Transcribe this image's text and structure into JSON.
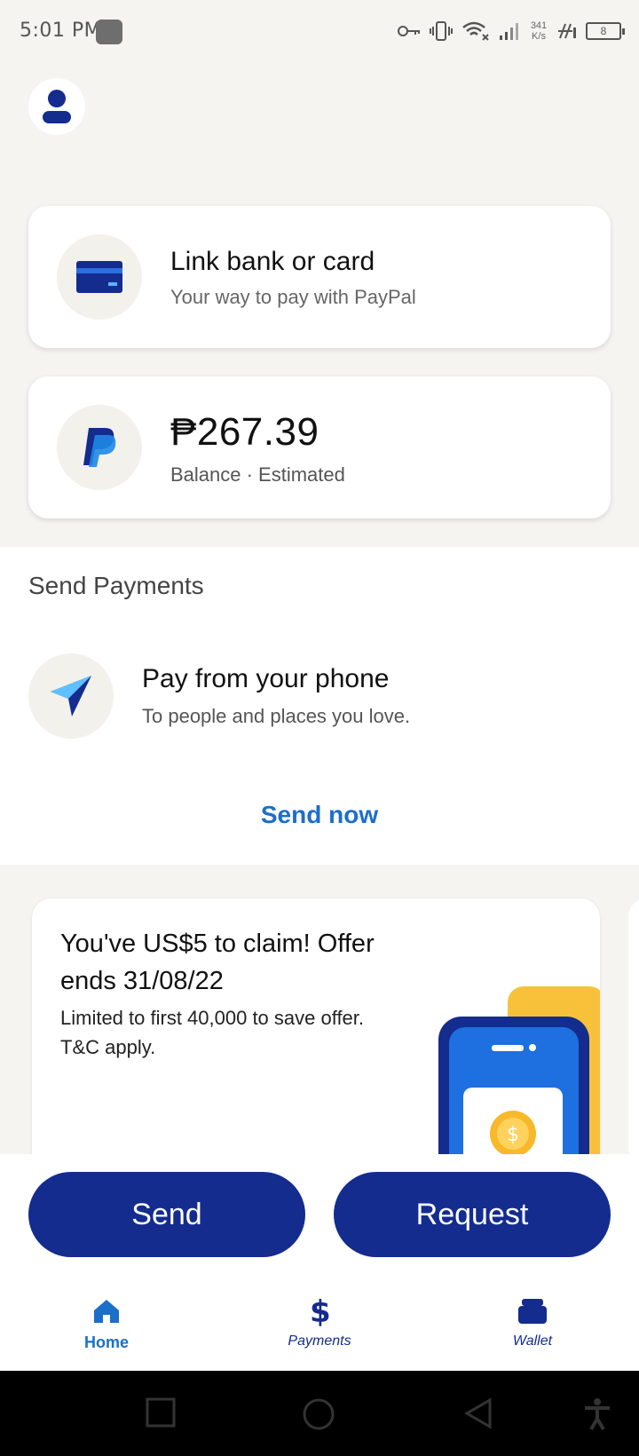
{
  "status_bar": {
    "time": "5:01 PM",
    "net_speed_value": "341",
    "net_speed_unit": "K/s",
    "battery": "8"
  },
  "profile": {
    "icon": "person-icon"
  },
  "link_card": {
    "title": "Link bank or card",
    "subtitle": "Your way to pay with PayPal",
    "icon": "credit-card-icon"
  },
  "balance_card": {
    "amount": "₱267.39",
    "subtitle": "Balance · Estimated",
    "icon": "paypal-logo"
  },
  "send_payments": {
    "section_title": "Send Payments",
    "title": "Pay from your phone",
    "subtitle": "To people and places you love.",
    "cta": "Send now",
    "icon": "send-paper-plane-icon"
  },
  "promo": {
    "title": "You've US$5 to claim! Offer ends 31/08/22",
    "subtitle": "Limited to first 40,000 to save offer. T&C apply."
  },
  "actions": {
    "send_label": "Send",
    "request_label": "Request"
  },
  "tabs": [
    {
      "label": "Home",
      "icon": "home-icon",
      "active": true
    },
    {
      "label": "Payments",
      "icon": "dollar-icon",
      "active": false
    },
    {
      "label": "Wallet",
      "icon": "wallet-icon",
      "active": false
    }
  ],
  "colors": {
    "brand_navy": "#142c8e",
    "link_blue": "#1c6fc9",
    "background": "#f5f4f1"
  }
}
